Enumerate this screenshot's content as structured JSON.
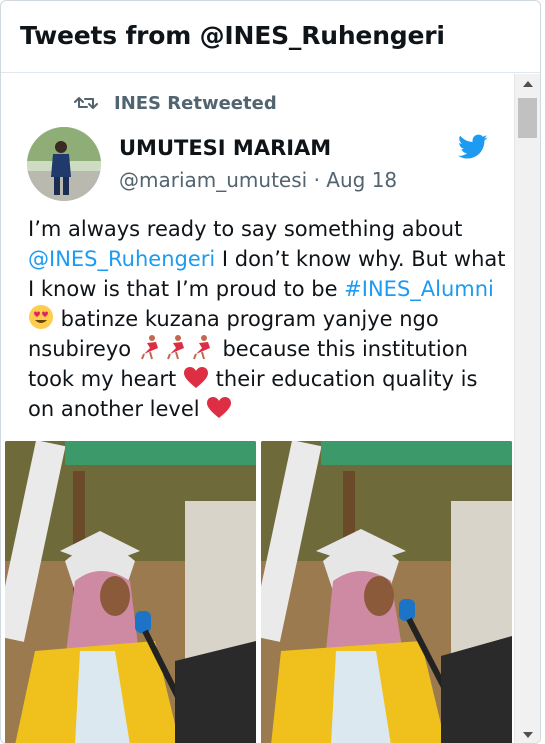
{
  "header": {
    "title": "Tweets from @INES_Ruhengeri"
  },
  "tweet": {
    "retweet_label": "INES Retweeted",
    "author_name": "UMUTESI MARIAM",
    "author_handle": "@mariam_umutesi",
    "separator": "·",
    "date": "Aug 18",
    "text": {
      "l1": "I’m always ready to say something about",
      "l2_link": "@INES_Ruhengeri",
      "l2_rest": " I don’t know why. But what",
      "l3_a": "I know is that I’m proud to be ",
      "l3_link": "#INES_Alumni",
      "l4_rest": " batinze kuzana program yanjye ngo",
      "l5_a": "nsubireyo ",
      "l5_b": " because this institution",
      "l6_a": "took my heart ",
      "l6_b": "  their education quality is",
      "l7_a": "on another level "
    },
    "media_count": 2
  },
  "colors": {
    "link": "#1d9bf0",
    "twitter_blue": "#1d9bf0",
    "muted": "#536471",
    "heart": "#e0245e"
  },
  "icons": [
    "retweet-icon",
    "twitter-bird-icon",
    "heart-eyes-emoji",
    "dancer-emoji",
    "red-heart-emoji"
  ]
}
